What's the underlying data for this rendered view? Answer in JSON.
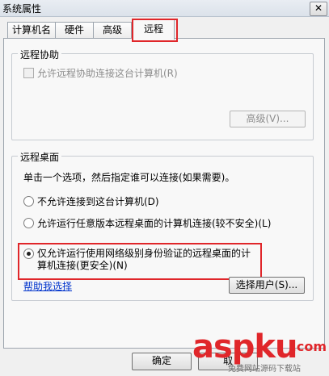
{
  "window": {
    "title": "系统属性",
    "close_glyph": "✕"
  },
  "tabs": [
    {
      "label": "计算机名"
    },
    {
      "label": "硬件"
    },
    {
      "label": "高级"
    },
    {
      "label": "远程"
    }
  ],
  "remote_assistance": {
    "legend": "远程协助",
    "allow_label": "允许远程协助连接这台计算机(R)",
    "allow_checked": false,
    "advanced_button": "高级(V)..."
  },
  "remote_desktop": {
    "legend": "远程桌面",
    "instruction": "单击一个选项，然后指定谁可以连接(如果需要)。",
    "options": [
      {
        "label": "不允许连接到这台计算机(D)",
        "selected": false
      },
      {
        "label": "允许运行任意版本远程桌面的计算机连接(较不安全)(L)",
        "selected": false
      },
      {
        "label_line1": "仅允许运行使用网络级别身份验证的远程桌面的计",
        "label_line2": "算机连接(更安全)(N)",
        "selected": true
      }
    ],
    "help_link": "帮助我选择",
    "select_users_button": "选择用户(S)..."
  },
  "footer": {
    "ok_button": "确定",
    "cancel_button_partial": "取"
  },
  "watermark": {
    "brand": "aspku",
    "suffix": ".com",
    "tagline": "免费网站源码下载站"
  },
  "colors": {
    "highlight": "#e0262a",
    "link": "#0033cc"
  }
}
